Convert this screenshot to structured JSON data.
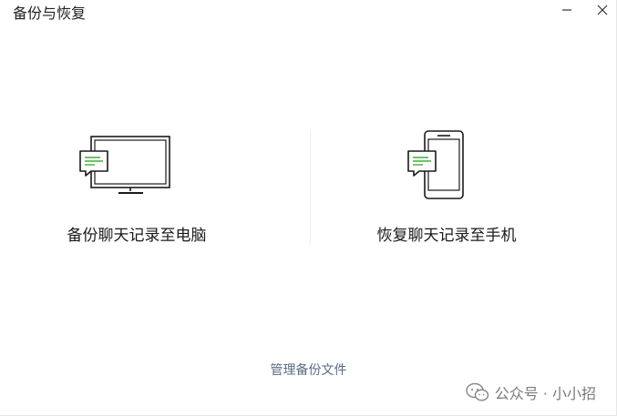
{
  "window": {
    "title": "备份与恢复",
    "minimize_icon": "minimize-icon",
    "close_icon": "close-icon"
  },
  "options": [
    {
      "label": "备份聊天记录至电脑",
      "icon": "monitor-chat-icon"
    },
    {
      "label": "恢复聊天记录至手机",
      "icon": "phone-chat-icon"
    }
  ],
  "footer": {
    "manage_link": "管理备份文件"
  },
  "watermark": {
    "text": "公众号 · 小小招",
    "icon": "wechat-logo-icon"
  },
  "colors": {
    "chat_line": "#3cb034",
    "icon_stroke": "#1a1a1a",
    "link": "#5a6b85",
    "divider": "#ececec"
  }
}
